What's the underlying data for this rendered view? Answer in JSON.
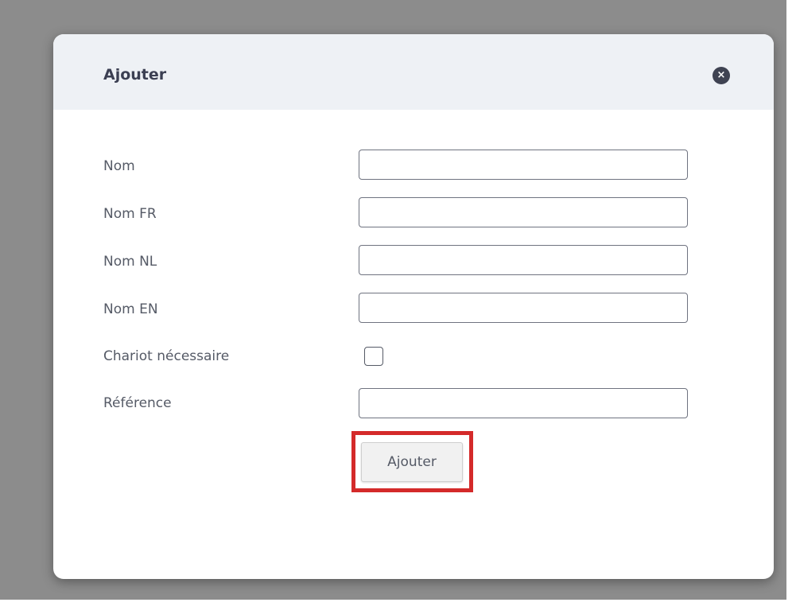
{
  "dialog": {
    "title": "Ajouter",
    "close_icon": "×"
  },
  "form": {
    "fields": [
      {
        "label": "Nom",
        "value": "",
        "type": "text"
      },
      {
        "label": "Nom FR",
        "value": "",
        "type": "text"
      },
      {
        "label": "Nom NL",
        "value": "",
        "type": "text"
      },
      {
        "label": "Nom EN",
        "value": "",
        "type": "text"
      },
      {
        "label": "Chariot nécessaire",
        "checked": false,
        "type": "checkbox"
      },
      {
        "label": "Référence",
        "value": "",
        "type": "text"
      }
    ],
    "submit_label": "Ajouter"
  },
  "colors": {
    "backdrop": "#8c8c8c",
    "header_background": "#eef1f5",
    "highlight": "#d42a2a"
  },
  "icons": {
    "close": "close-icon"
  }
}
